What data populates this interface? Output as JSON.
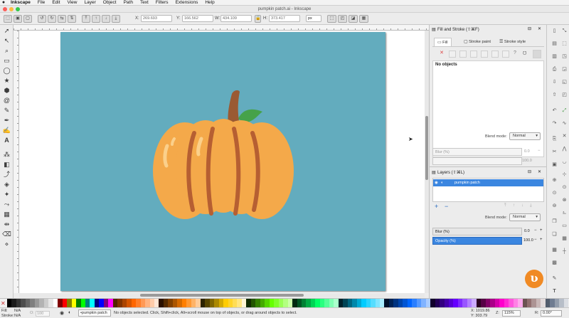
{
  "menubar": {
    "apple": "",
    "app_name": "Inkscape",
    "items": [
      "File",
      "Edit",
      "View",
      "Layer",
      "Object",
      "Path",
      "Text",
      "Filters",
      "Extensions",
      "Help"
    ]
  },
  "window": {
    "title": "pumpkin patch.ai - Inkscape"
  },
  "controls": {
    "x_label": "X:",
    "x_value": "269.693",
    "y_label": "Y:",
    "y_value": "166.562",
    "w_label": "W:",
    "w_value": "434.109",
    "h_label": "H:",
    "h_value": "373.417",
    "unit": "px"
  },
  "fill_stroke": {
    "title": "Fill and Stroke (⇧⌘F)",
    "tabs": [
      "Fill",
      "Stroke paint",
      "Stroke style"
    ],
    "no_objects": "No objects",
    "blend_label": "Blend mode:",
    "blend_value": "Normal",
    "blur_label": "Blur (%)",
    "blur_value": "0.0",
    "opacity_value": "100.0"
  },
  "layers": {
    "title": "Layers (⇧⌘L)",
    "layer_name": "pumpkin patch",
    "blend_label": "Blend mode:",
    "blend_value": "Normal",
    "blur_label": "Blur (%)",
    "blur_value": "0.0",
    "opacity_label": "Opacity (%)",
    "opacity_value": "100.0"
  },
  "status": {
    "fill_label": "Fill:",
    "fill_value": "N/A",
    "stroke_label": "Stroke:",
    "stroke_value": "N/A",
    "o_value": "100",
    "layer_select": "•pumpkin patch",
    "message": "No objects selected. Click, Shift+click, Alt+scroll mouse on top of objects, or drag around objects to select.",
    "x_coord": "X: 1019.86",
    "y_coord": "Y: 303.79",
    "z_label": "Z:",
    "zoom": "115%",
    "r_label": "R:",
    "rotation": "0.00°"
  },
  "colors": {
    "canvas_bg": "#63acbe",
    "pumpkin": "#f4a94a",
    "pumpkin_ribs": "#b65f32",
    "highlight": "#fbd08b",
    "stem": "#9a5a33",
    "leaf": "#46a24a",
    "selection_blue": "#3b86e0"
  },
  "palette": [
    "#000000",
    "#1a1a1a",
    "#333333",
    "#4d4d4d",
    "#666666",
    "#808080",
    "#999999",
    "#b3b3b3",
    "#cccccc",
    "#e6e6e6",
    "#ffffff",
    "#800000",
    "#ff0000",
    "#808000",
    "#ffff00",
    "#008000",
    "#00ff00",
    "#008080",
    "#00ffff",
    "#000080",
    "#0000ff",
    "#800080",
    "#ff00ff",
    "#552200",
    "#803300",
    "#aa4400",
    "#d45500",
    "#ff6600",
    "#ff7f2a",
    "#ff9955",
    "#ffb380",
    "#ffccaa",
    "#ffe6d5",
    "#2b1100",
    "#552b00",
    "#804000",
    "#aa5500",
    "#d46a00",
    "#ff7f00",
    "#ff9933",
    "#ffb366",
    "#ffcc99",
    "#2b2200",
    "#554400",
    "#806600",
    "#aa8800",
    "#d4aa00",
    "#ffcc00",
    "#ffd42a",
    "#ffdd55",
    "#ffe680",
    "#fff6d5",
    "#112b00",
    "#225500",
    "#338000",
    "#44aa00",
    "#55d400",
    "#66ff00",
    "#7fff2a",
    "#99ff55",
    "#b3ff80",
    "#ccffaa",
    "#002b11",
    "#005522",
    "#008033",
    "#00aa44",
    "#00d455",
    "#00ff66",
    "#2aff80",
    "#55ff99",
    "#80ffb3",
    "#aaffcc",
    "#00222b",
    "#004455",
    "#006680",
    "#0088aa",
    "#00aad4",
    "#00ccff",
    "#2ad4ff",
    "#55ddff",
    "#80e5ff",
    "#aaeeff",
    "#00112b",
    "#002255",
    "#003380",
    "#0044aa",
    "#0055d4",
    "#0066ff",
    "#2a7fff",
    "#5599ff",
    "#80b3ff",
    "#aaccff",
    "#11002b",
    "#220055",
    "#330080",
    "#4400aa",
    "#5500d4",
    "#6600ff",
    "#7f2aff",
    "#9955ff",
    "#b380ff",
    "#ccaaff",
    "#2b0022",
    "#550044",
    "#800066",
    "#aa0088",
    "#d400aa",
    "#ff00cc",
    "#ff2ad4",
    "#ff55dd",
    "#ff80e5",
    "#ffaaee",
    "#6c5353",
    "#916f6f",
    "#ac9393",
    "#c8b7b7",
    "#e3dbdb",
    "#535d6c",
    "#6f7c91",
    "#939dac",
    "#b7bec8",
    "#dbdee3"
  ]
}
